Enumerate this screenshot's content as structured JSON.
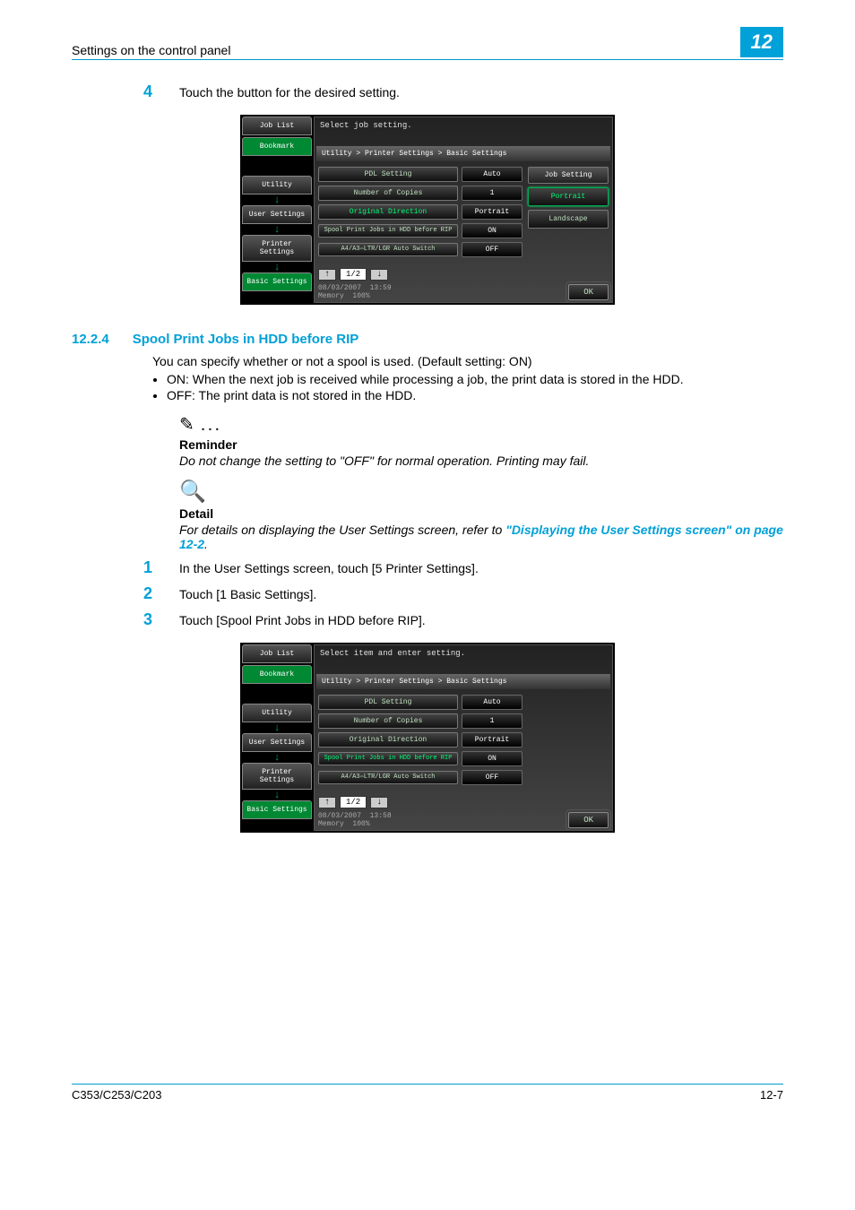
{
  "header": {
    "title": "Settings on the control panel",
    "chapter": "12"
  },
  "step4": {
    "num": "4",
    "text": "Touch the button for the desired setting."
  },
  "panel1": {
    "head": "Select job setting.",
    "breadcrumb": "Utility > Printer Settings > Basic Settings",
    "tabs": {
      "jobList": "Job List",
      "bookmark": "Bookmark",
      "utility": "Utility",
      "userSettings": "User Settings",
      "printerSettings": "Printer Settings",
      "basicSettings": "Basic Settings"
    },
    "rows": [
      {
        "label": "PDL Setting",
        "val": "Auto",
        "hl": false
      },
      {
        "label": "Number of Copies",
        "val": "1",
        "hl": false
      },
      {
        "label": "Original Direction",
        "val": "Portrait",
        "hl": true
      },
      {
        "label": "Spool Print Jobs in HDD before RIP",
        "val": "ON",
        "hl": false
      },
      {
        "label": "A4/A3⇔LTR/LGR Auto Switch",
        "val": "OFF",
        "hl": false
      }
    ],
    "side": {
      "title": "Job Setting",
      "portrait": "Portrait",
      "landscape": "Landscape"
    },
    "pager": {
      "page": "1/2"
    },
    "foot": {
      "date": "08/03/2007",
      "time": "13:59",
      "memLabel": "Memory",
      "memVal": "100%",
      "ok": "OK"
    }
  },
  "section": {
    "num": "12.2.4",
    "title": "Spool Print Jobs in HDD before RIP",
    "intro": "You can specify whether or not a spool is used. (Default setting: ON)",
    "b1": "ON: When the next job is received while processing a job, the print data is stored in the HDD.",
    "b2": "OFF: The print data is not stored in the HDD."
  },
  "reminder": {
    "head": "Reminder",
    "body": "Do not change the setting to \"OFF\" for normal operation. Printing may fail."
  },
  "detail": {
    "head": "Detail",
    "pre": "For details on displaying the User Settings screen, refer to ",
    "link": "\"Displaying the User Settings screen\" on page 12-2",
    "post": "."
  },
  "steps": {
    "s1": {
      "num": "1",
      "text": "In the User Settings screen, touch [5 Printer Settings]."
    },
    "s2": {
      "num": "2",
      "text": "Touch [1 Basic Settings]."
    },
    "s3": {
      "num": "3",
      "text": "Touch [Spool Print Jobs in HDD before RIP]."
    }
  },
  "panel2": {
    "head": "Select item and enter setting.",
    "breadcrumb": "Utility > Printer Settings > Basic Settings",
    "rows": [
      {
        "label": "PDL Setting",
        "val": "Auto",
        "hl": false
      },
      {
        "label": "Number of Copies",
        "val": "1",
        "hl": false
      },
      {
        "label": "Original Direction",
        "val": "Portrait",
        "hl": false
      },
      {
        "label": "Spool Print Jobs in HDD before RIP",
        "val": "ON",
        "hl": true
      },
      {
        "label": "A4/A3⇔LTR/LGR Auto Switch",
        "val": "OFF",
        "hl": false
      }
    ],
    "pager": {
      "page": "1/2"
    },
    "foot": {
      "date": "08/03/2007",
      "time": "13:58",
      "memLabel": "Memory",
      "memVal": "100%",
      "ok": "OK"
    }
  },
  "footer": {
    "model": "C353/C253/C203",
    "page": "12-7"
  }
}
